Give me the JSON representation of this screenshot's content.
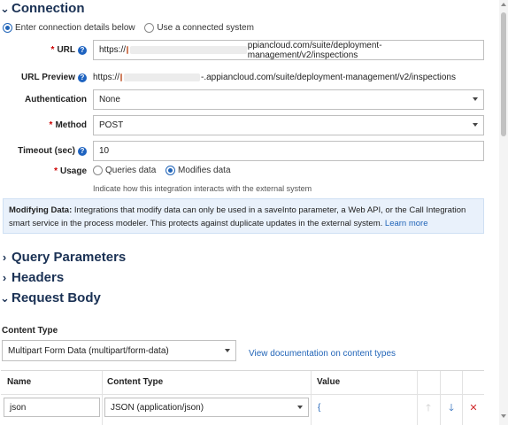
{
  "connection": {
    "title": "Connection",
    "mode_options": [
      {
        "label": "Enter connection details below",
        "selected": true
      },
      {
        "label": "Use a connected system",
        "selected": false
      }
    ]
  },
  "url": {
    "label": "URL",
    "value_prefix": "https://",
    "value_suffix": "ppiancloud.com/suite/deployment-management/v2/inspections"
  },
  "url_preview": {
    "label": "URL Preview",
    "value_prefix": "https://",
    "value_suffix": "-.appiancloud.com/suite/deployment-management/v2/inspections"
  },
  "authentication": {
    "label": "Authentication",
    "value": "None"
  },
  "method": {
    "label": "Method",
    "value": "POST"
  },
  "timeout": {
    "label": "Timeout (sec)",
    "value": "10"
  },
  "usage": {
    "label": "Usage",
    "options": [
      {
        "label": "Queries data",
        "selected": false
      },
      {
        "label": "Modifies data",
        "selected": true
      }
    ],
    "hint": "Indicate how this integration interacts with the external system"
  },
  "info": {
    "bold": "Modifying Data:",
    "text": " Integrations that modify data can only be used in a saveInto parameter, a Web API, or the Call Integration smart service in the process modeler. This protects against duplicate updates in the external system. ",
    "link": "Learn more"
  },
  "sections": {
    "query_parameters": "Query Parameters",
    "headers": "Headers",
    "request_body": "Request Body"
  },
  "request_body": {
    "content_type_label": "Content Type",
    "content_type_value": "Multipart Form Data (multipart/form-data)",
    "doc_link": "View documentation on content types",
    "table": {
      "headers": [
        "Name",
        "Content Type",
        "Value"
      ],
      "rows": [
        {
          "name": "json",
          "content_type": "JSON (application/json)",
          "value": "{"
        }
      ]
    }
  },
  "icons": {
    "help": "help-icon",
    "move_up": "arrow-up-icon",
    "move_down": "arrow-down-icon",
    "remove": "remove-x-icon",
    "expand": "chevron-right-icon",
    "collapse": "chevron-down-icon"
  },
  "colors": {
    "accent": "#2265b8",
    "title": "#1a3154",
    "info_bg": "#e9f1fb",
    "required": "#cc0000",
    "remove": "#d0292b"
  }
}
